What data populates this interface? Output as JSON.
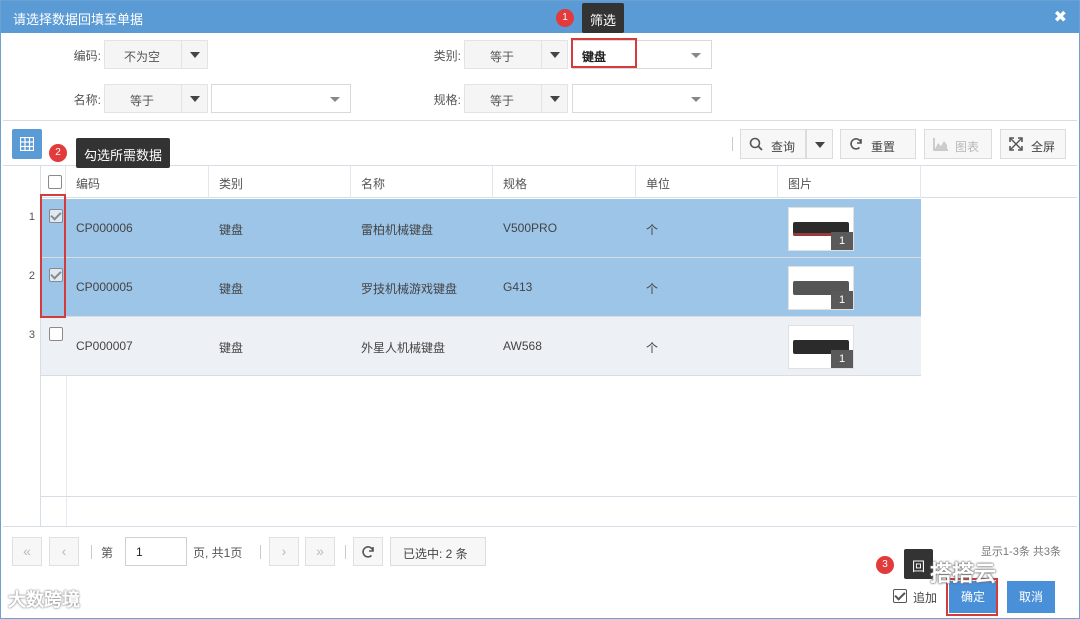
{
  "dialog": {
    "title": "请选择数据回填至单据",
    "close_symbol": "✖"
  },
  "filters": {
    "code": {
      "label": "编码:",
      "operator": "不为空",
      "value": ""
    },
    "category": {
      "label": "类别:",
      "operator": "等于",
      "value": "键盘"
    },
    "name": {
      "label": "名称:",
      "operator": "等于",
      "value": ""
    },
    "spec": {
      "label": "规格:",
      "operator": "等于",
      "value": ""
    }
  },
  "toolbar": {
    "query_label": "查询",
    "reset_label": "重置",
    "chart_label": "图表",
    "fullscreen_label": "全屏"
  },
  "table": {
    "columns": [
      "编码",
      "类别",
      "名称",
      "规格",
      "单位",
      "图片"
    ],
    "rows": [
      {
        "index": "1",
        "code": "CP000006",
        "category": "键盘",
        "name": "雷柏机械键盘",
        "spec": "V500PRO",
        "unit": "个",
        "image_count": "1",
        "checked": true
      },
      {
        "index": "2",
        "code": "CP000005",
        "category": "键盘",
        "name": "罗技机械游戏键盘",
        "spec": "G413",
        "unit": "个",
        "image_count": "1",
        "checked": true
      },
      {
        "index": "3",
        "code": "CP000007",
        "category": "键盘",
        "name": "外星人机械键盘",
        "spec": "AW568",
        "unit": "个",
        "image_count": "1",
        "checked": false
      }
    ]
  },
  "pager": {
    "page_prefix": "第",
    "page_value": "1",
    "page_suffix": "页, 共1页",
    "selected_text": "已选中: 2 条",
    "summary": "显示1-3条 共3条"
  },
  "footer": {
    "append_label": "追加",
    "confirm_label": "确定",
    "cancel_label": "取消"
  },
  "annotations": {
    "step1_num": "1",
    "step1_text": "筛选",
    "step2_num": "2",
    "step2_text": "勾选所需数据",
    "step3_num": "3",
    "step3_text": "回"
  },
  "watermarks": {
    "left": "大数跨境",
    "right": "搭搭云"
  },
  "colors": {
    "accent": "#5b9bd5",
    "selected_row": "#9cc5e8",
    "annotation_red": "#d43c3c"
  }
}
